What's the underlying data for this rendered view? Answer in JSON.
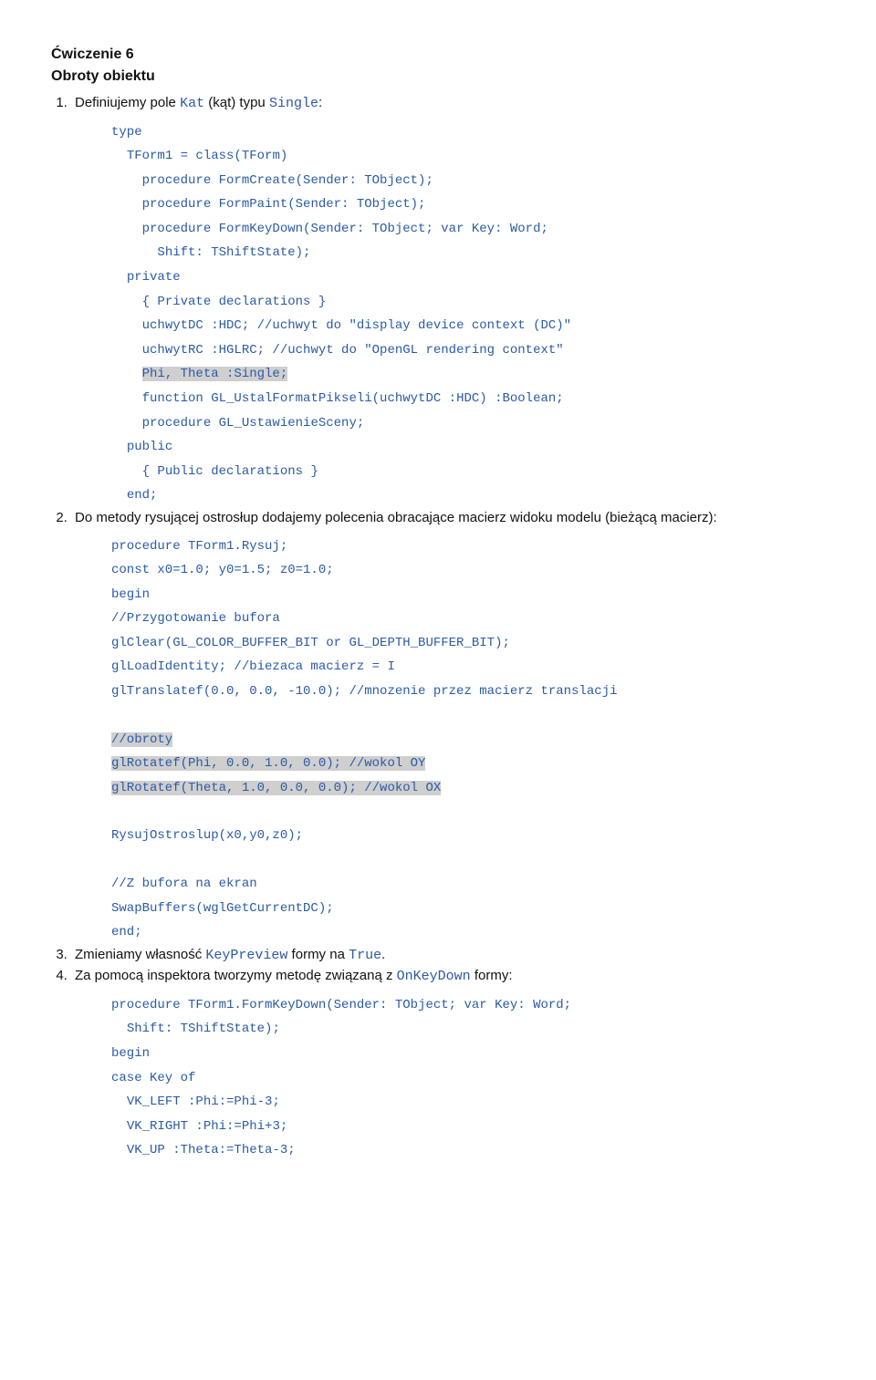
{
  "heading": {
    "line1": "Ćwiczenie 6",
    "line2": "Obroty obiektu"
  },
  "items": [
    {
      "text_parts": [
        "Definiujemy pole ",
        "Kat",
        " (kąt) typu ",
        "Single",
        ":"
      ],
      "code_lines": [
        {
          "indent": 0,
          "t": "type",
          "hl": false
        },
        {
          "indent": 1,
          "t": "TForm1 = class(TForm)",
          "hl": false
        },
        {
          "indent": 2,
          "t": "procedure FormCreate(Sender: TObject);",
          "hl": false
        },
        {
          "indent": 2,
          "t": "procedure FormPaint(Sender: TObject);",
          "hl": false
        },
        {
          "indent": 2,
          "t": "procedure FormKeyDown(Sender: TObject; var Key: Word;",
          "hl": false
        },
        {
          "indent": 3,
          "t": "Shift: TShiftState);",
          "hl": false
        },
        {
          "indent": 1,
          "t": "private",
          "hl": false
        },
        {
          "indent": 2,
          "t": "{ Private declarations }",
          "hl": false
        },
        {
          "indent": 2,
          "t": "uchwytDC :HDC; //uchwyt do \"display device context (DC)\"",
          "hl": false
        },
        {
          "indent": 2,
          "t": "uchwytRC :HGLRC; //uchwyt do \"OpenGL rendering context\"",
          "hl": false
        },
        {
          "indent": 2,
          "t": "Phi, Theta :Single;",
          "hl": true
        },
        {
          "indent": 2,
          "t": "function GL_UstalFormatPikseli(uchwytDC :HDC) :Boolean;",
          "hl": false
        },
        {
          "indent": 2,
          "t": "procedure GL_UstawienieSceny;",
          "hl": false
        },
        {
          "indent": 1,
          "t": "public",
          "hl": false
        },
        {
          "indent": 2,
          "t": "{ Public declarations }",
          "hl": false
        },
        {
          "indent": 1,
          "t": "end;",
          "hl": false
        }
      ]
    },
    {
      "text_parts": [
        "Do metody rysującej ostrosłup dodajemy polecenia obracające macierz widoku modelu (bieżącą macierz):"
      ],
      "code_lines": [
        {
          "indent": 0,
          "t": "procedure TForm1.Rysuj;",
          "hl": false
        },
        {
          "indent": 0,
          "t": "const x0=1.0; y0=1.5; z0=1.0;",
          "hl": false
        },
        {
          "indent": 0,
          "t": "begin",
          "hl": false
        },
        {
          "indent": 0,
          "t": "//Przygotowanie bufora",
          "hl": false
        },
        {
          "indent": 0,
          "t": "glClear(GL_COLOR_BUFFER_BIT or GL_DEPTH_BUFFER_BIT);",
          "hl": false
        },
        {
          "indent": 0,
          "t": "glLoadIdentity; //biezaca macierz = I",
          "hl": false
        },
        {
          "indent": 0,
          "t": "glTranslatef(0.0, 0.0, -10.0); //mnozenie przez macierz translacji",
          "hl": false
        },
        {
          "indent": 0,
          "t": "",
          "hl": false,
          "blank": true
        },
        {
          "indent": 0,
          "t": "//obroty",
          "hl": true
        },
        {
          "indent": 0,
          "t": "glRotatef(Phi, 0.0, 1.0, 0.0); //wokol OY",
          "hl": true
        },
        {
          "indent": 0,
          "t": "glRotatef(Theta, 1.0, 0.0, 0.0); //wokol OX",
          "hl": true
        },
        {
          "indent": 0,
          "t": "",
          "hl": false,
          "blank": true
        },
        {
          "indent": 0,
          "t": "RysujOstroslup(x0,y0,z0);",
          "hl": false
        },
        {
          "indent": 0,
          "t": "",
          "hl": false,
          "blank": true
        },
        {
          "indent": 0,
          "t": "//Z bufora na ekran",
          "hl": false
        },
        {
          "indent": 0,
          "t": "SwapBuffers(wglGetCurrentDC);",
          "hl": false
        },
        {
          "indent": 0,
          "t": "end;",
          "hl": false
        }
      ]
    },
    {
      "text_parts": [
        "Zmieniamy własność ",
        "KeyPreview",
        " formy na ",
        "True",
        "."
      ]
    },
    {
      "text_parts": [
        "Za pomocą inspektora tworzymy metodę związaną z ",
        "OnKeyDown",
        " formy:"
      ],
      "code_lines": [
        {
          "indent": 0,
          "t": "procedure TForm1.FormKeyDown(Sender: TObject; var Key: Word;",
          "hl": false
        },
        {
          "indent": 1,
          "t": "Shift: TShiftState);",
          "hl": false
        },
        {
          "indent": 0,
          "t": "begin",
          "hl": false
        },
        {
          "indent": 0,
          "t": "case Key of",
          "hl": false
        },
        {
          "indent": 1,
          "t": "VK_LEFT :Phi:=Phi-3;",
          "hl": false
        },
        {
          "indent": 1,
          "t": "VK_RIGHT :Phi:=Phi+3;",
          "hl": false
        },
        {
          "indent": 1,
          "t": "VK_UP :Theta:=Theta-3;",
          "hl": false
        }
      ]
    }
  ]
}
